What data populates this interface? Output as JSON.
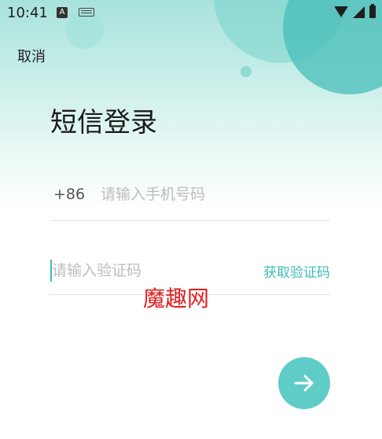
{
  "status_bar": {
    "time": "10:41",
    "icons": [
      "a-notification-icon",
      "keyboard-icon",
      "wifi-icon",
      "signal-icon",
      "battery-charging-icon"
    ],
    "badge_letter": "A"
  },
  "header": {
    "cancel_label": "取消"
  },
  "login": {
    "title": "短信登录",
    "phone": {
      "country_code": "+86",
      "value": "",
      "placeholder": "请输入手机号码"
    },
    "code": {
      "value": "",
      "placeholder": "请输入验证码",
      "get_code_label": "获取验证码"
    },
    "submit_icon": "arrow-right-icon"
  },
  "watermark": "魔趣网",
  "colors": {
    "accent": "#3dbdb3",
    "submit_bg": "#5fcdc6",
    "watermark": "#e02020"
  }
}
